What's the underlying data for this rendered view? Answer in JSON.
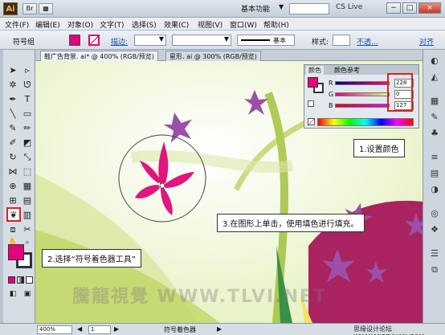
{
  "app": {
    "logo": "Ai",
    "workspace": "基本功能",
    "cslive": "CS Live",
    "window_buttons": [
      "−",
      "□",
      "×"
    ]
  },
  "menu": [
    "文件(F)",
    "编辑(E)",
    "对象(O)",
    "文字(T)",
    "选择(S)",
    "效果(C)",
    "视图(V)",
    "窗口(W)",
    "帮助(H)"
  ],
  "control_bar": {
    "object_label": "符号组",
    "stroke_label": "描边:",
    "style_label": "基本",
    "styles_label": "样式:",
    "opacity_link": "不透...",
    "align_link": "对齐",
    "fill_color": "#e4007f"
  },
  "tabs": [
    {
      "label": "鞋广告背景. ai* @ 400% (RGB/预览)",
      "active": true
    },
    {
      "label": "星形. ai @ 300% (RGB/预览)",
      "active": false
    }
  ],
  "color_panel": {
    "tabs": [
      "颜色",
      "颜色参考"
    ],
    "channels": [
      {
        "name": "R",
        "value": "228"
      },
      {
        "name": "G",
        "value": "0"
      },
      {
        "name": "B",
        "value": "127"
      }
    ]
  },
  "callouts": {
    "set_color": "1.设置颜色",
    "select_tool": "2.选择“符号着色器工具”",
    "click_fill": "3.在图形上单击，使用填色进行填充。"
  },
  "statusbar": {
    "zoom": "400%",
    "page": "1",
    "tool_name": "符号着色器"
  },
  "watermark": "騰龍視覺 WWW.TLVI.NET",
  "site_mark": "思缘设计论坛 WWW.MISSYUAN.COM",
  "colors": {
    "accent_magenta": "#e4007f",
    "flower_purple": "#9b4fa8",
    "grass_green": "#a8c43a",
    "highlight_red": "#e02020"
  }
}
